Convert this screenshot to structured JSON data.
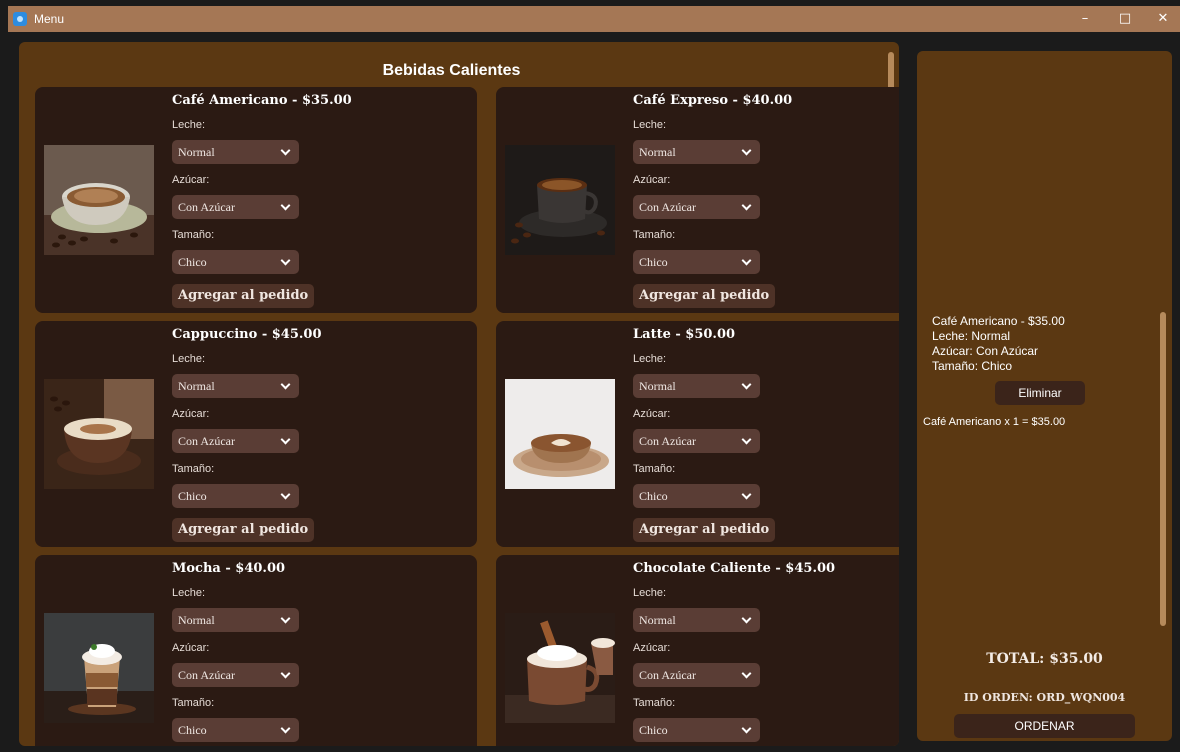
{
  "window": {
    "title": "Menu",
    "minimize": "–",
    "maximize": "□",
    "close": "✕"
  },
  "menu": {
    "section_title": "Bebidas Calientes",
    "field_labels": {
      "leche": "Leche:",
      "azucar": "Azúcar:",
      "tamano": "Tamaño:"
    },
    "add_label": "Agregar al pedido",
    "items": [
      {
        "name": "Café Americano - $35.00",
        "leche": "Normal",
        "azucar": "Con Azúcar",
        "tamano": "Chico",
        "image": "coffee-cup-icon"
      },
      {
        "name": "Café Expreso - $40.00",
        "leche": "Normal",
        "azucar": "Con Azúcar",
        "tamano": "Chico",
        "image": "espresso-cup-icon"
      },
      {
        "name": "Cappuccino - $45.00",
        "leche": "Normal",
        "azucar": "Con Azúcar",
        "tamano": "Chico",
        "image": "cappuccino-icon"
      },
      {
        "name": "Latte - $50.00",
        "leche": "Normal",
        "azucar": "Con Azúcar",
        "tamano": "Chico",
        "image": "latte-art-icon"
      },
      {
        "name": "Mocha - $40.00",
        "leche": "Normal",
        "azucar": "Con Azúcar",
        "tamano": "Chico",
        "image": "mocha-glass-icon"
      },
      {
        "name": "Chocolate Caliente - $45.00",
        "leche": "Normal",
        "azucar": "Con Azúcar",
        "tamano": "Chico",
        "image": "hot-chocolate-icon"
      }
    ]
  },
  "order": {
    "items": [
      {
        "line1": "Café Americano - $35.00",
        "line2": "Leche: Normal",
        "line3": "Azúcar: Con Azúcar",
        "line4": "Tamaño: Chico"
      }
    ],
    "remove_label": "Eliminar",
    "summary": "Café Americano x 1 = $35.00",
    "total": "TOTAL: $35.00",
    "order_id": "ID ORDEN: ORD_WQN004",
    "submit_label": "ORDENAR"
  },
  "colors": {
    "panel": "#5b3812",
    "card": "#2b1a13",
    "select": "#5a3d35",
    "titlebar": "#a57755",
    "scrollbar": "#b68a5b"
  }
}
